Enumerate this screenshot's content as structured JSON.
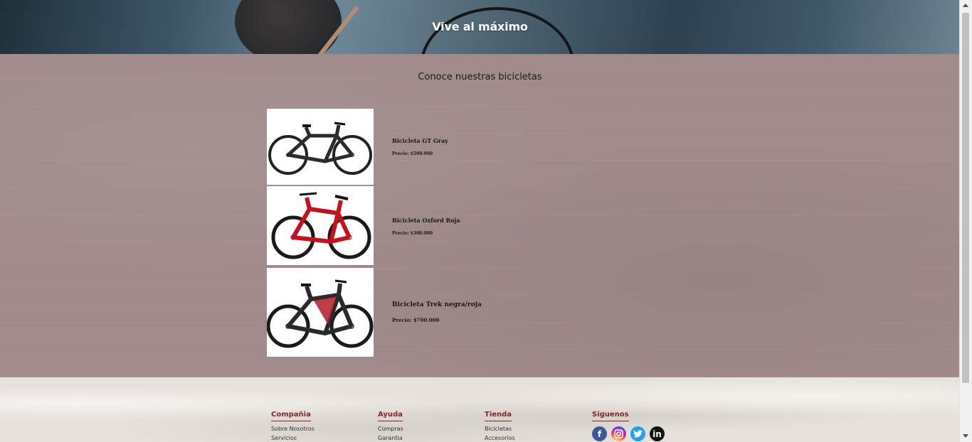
{
  "hero": {
    "title": "Vive al máximo"
  },
  "section": {
    "title": "Conoce nuestras bicicletas"
  },
  "products": [
    {
      "name": "Bicicleta GT Gray",
      "price": "Precio: $500.000",
      "frame_color": "#2b2b2b",
      "accent_color": "#555555"
    },
    {
      "name": "Bicicleta Oxford Roja",
      "price": "Precio: $300.000",
      "frame_color": "#c4111d",
      "accent_color": "#1a1a1a"
    },
    {
      "name": "Bicicleta Trek negra/roja",
      "price": "Precio: $700.000",
      "frame_color": "#2a2a2a",
      "accent_color": "#b01a2a"
    }
  ],
  "footer": {
    "columns": [
      {
        "heading": "Compañia",
        "links": [
          "Sobre Nosotros",
          "Servicios"
        ]
      },
      {
        "heading": "Ayuda",
        "links": [
          "Compras",
          "Garantia"
        ]
      },
      {
        "heading": "Tienda",
        "links": [
          "Bicicletas",
          "Accesorios"
        ]
      }
    ],
    "social": {
      "heading": "Siguenos",
      "icons": [
        "facebook-icon",
        "instagram-icon",
        "twitter-icon",
        "linkedin-icon"
      ]
    },
    "accent_color": "#7d2731"
  },
  "colors": {
    "products_background": "#a08a8c",
    "footer_background": "#e6e1dc"
  }
}
